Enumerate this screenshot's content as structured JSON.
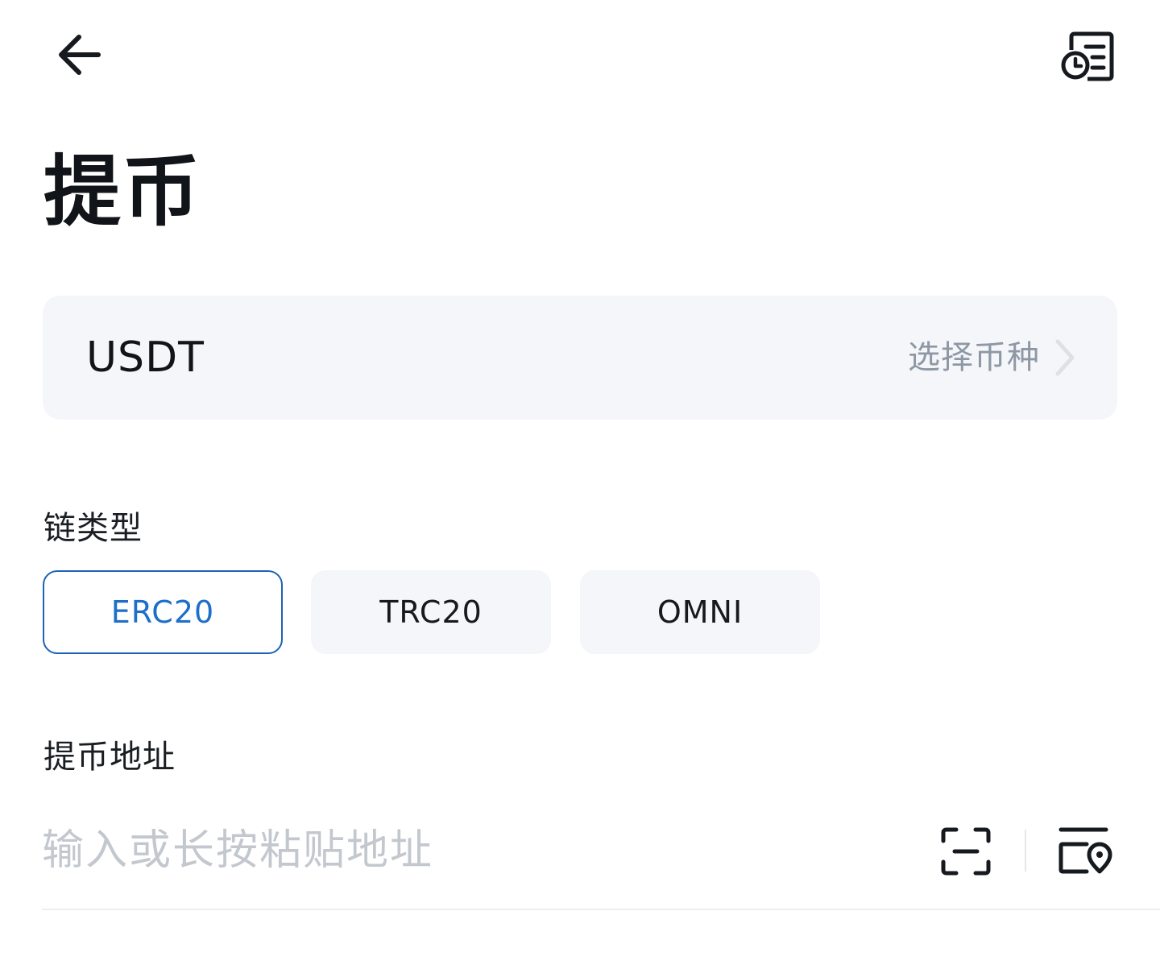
{
  "header": {
    "back_icon": "arrow-left-icon",
    "history_icon": "withdraw-history-icon"
  },
  "page": {
    "title": "提币"
  },
  "coin_selector": {
    "coin": "USDT",
    "hint": "选择币种",
    "chevron_icon": "chevron-right-icon"
  },
  "chain": {
    "label": "链类型",
    "options": [
      {
        "label": "ERC20",
        "selected": true
      },
      {
        "label": "TRC20",
        "selected": false
      },
      {
        "label": "OMNI",
        "selected": false
      }
    ]
  },
  "address": {
    "label": "提币地址",
    "value": "",
    "placeholder": "输入或长按粘贴地址",
    "scan_icon": "scan-icon",
    "address_book_icon": "address-book-icon"
  },
  "colors": {
    "accent": "#1d6fc8",
    "chip_bg": "#f5f6fa",
    "placeholder": "#c3c8cf",
    "hint": "#8e98a5"
  }
}
